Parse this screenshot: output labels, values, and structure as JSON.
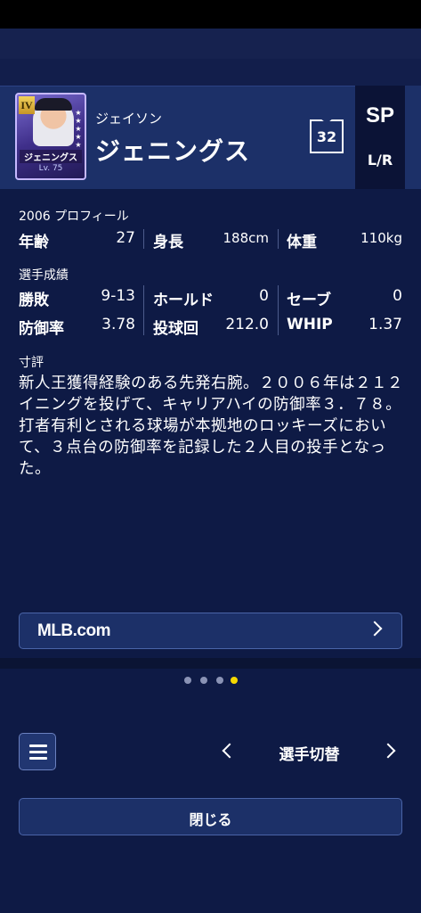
{
  "player": {
    "card_name": "ジェニングス",
    "card_level": "Lv. 75",
    "card_rank": "IV",
    "first_name": "ジェイソン",
    "last_name": "ジェニングス",
    "number": "32",
    "position": "SP",
    "handedness": "L/R"
  },
  "profile": {
    "title": "2006 プロフィール",
    "age_label": "年齢",
    "age_value": "27",
    "height_label": "身長",
    "height_value": "188cm",
    "weight_label": "体重",
    "weight_value": "110kg"
  },
  "record": {
    "title": "選手成績",
    "wl_label": "勝敗",
    "wl_value": "9-13",
    "hold_label": "ホールド",
    "hold_value": "0",
    "save_label": "セーブ",
    "save_value": "0",
    "era_label": "防御率",
    "era_value": "3.78",
    "ip_label": "投球回",
    "ip_value": "212.0",
    "whip_label": "WHIP",
    "whip_value": "1.37"
  },
  "review": {
    "title": "寸評",
    "text": "新人王獲得経験のある先発右腕。２００６年は２１２イニングを投げて、キャリアハイの防御率３．７８。打者有利とされる球場が本拠地のロッキーズにおいて、３点台の防御率を記録した２人目の投手となった。"
  },
  "links": {
    "mlb_label": "MLB.com"
  },
  "pager": {
    "active_index": 3,
    "count": 4
  },
  "footer": {
    "switch_label": "選手切替",
    "close_label": "閉じる"
  },
  "colors": {
    "background": "#0e1a45",
    "header": "#1c3068",
    "dot_active": "#f5d800",
    "dot_inactive": "#8a93b5"
  }
}
